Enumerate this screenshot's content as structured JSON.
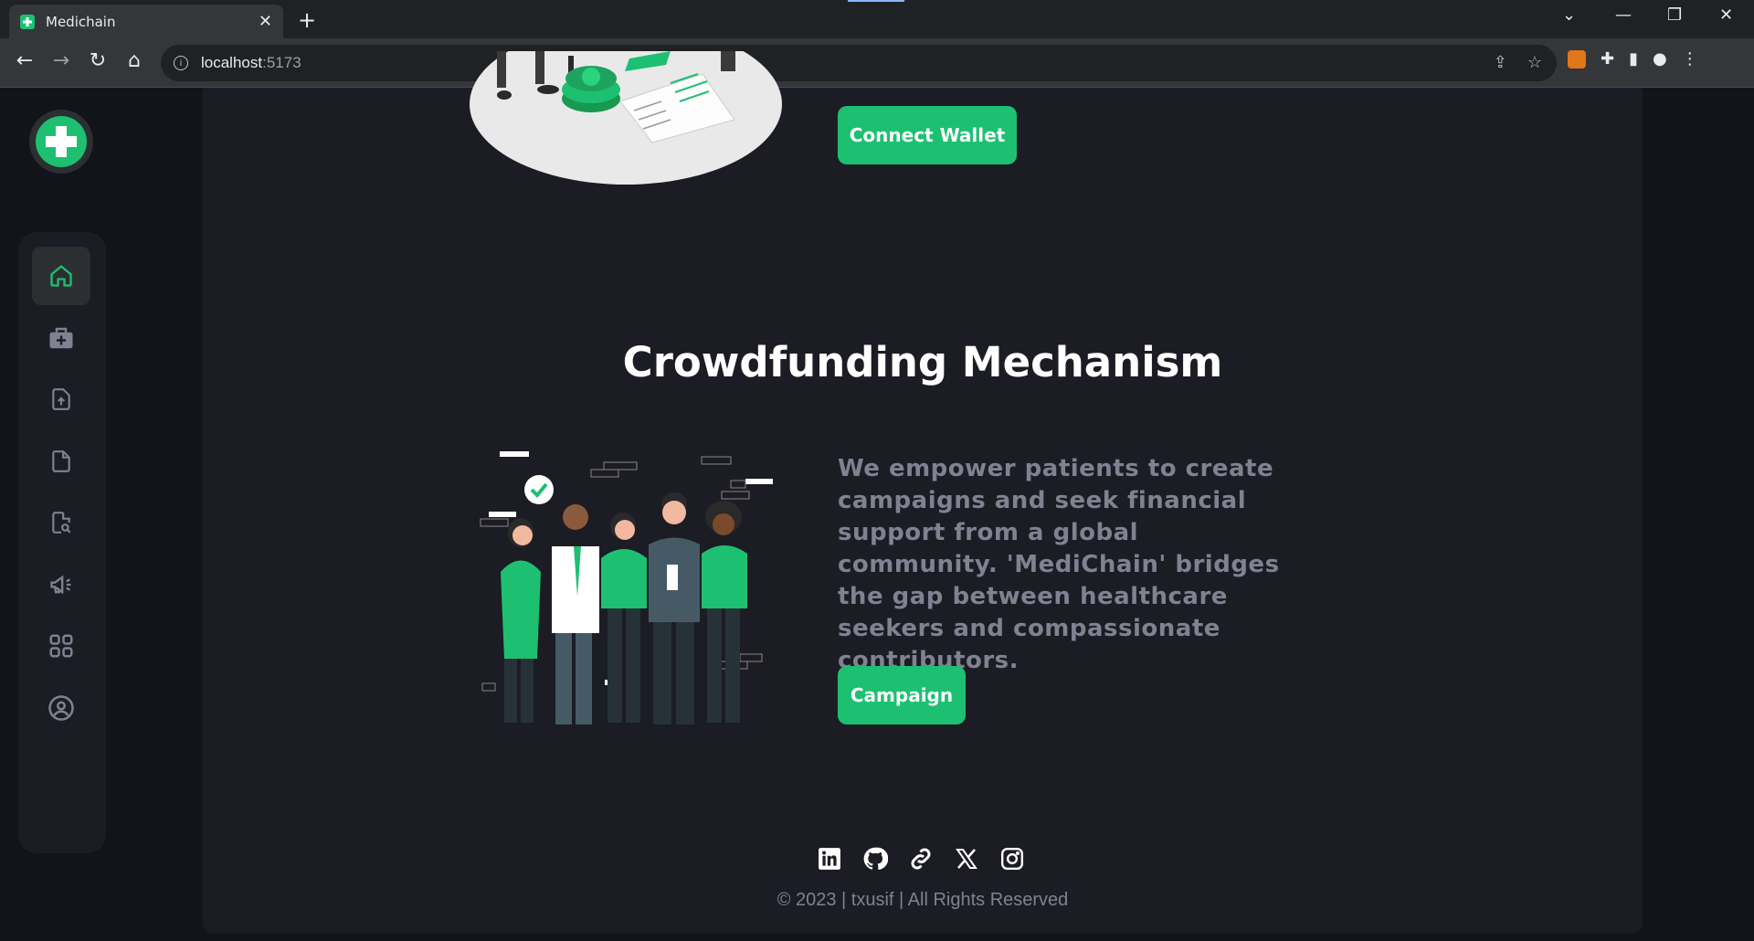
{
  "browser": {
    "tab_title": "Medichain",
    "url_host": "localhost",
    "url_port": ":5173"
  },
  "hero": {
    "connect_label": "Connect Wallet"
  },
  "section": {
    "title": "Crowdfunding Mechanism",
    "description": "We empower patients to create campaigns and seek financial support from a global community. 'MediChain' bridges the gap between healthcare seekers and compassionate contributors.",
    "campaign_label": "Campaign"
  },
  "sidebar": {
    "items": [
      "home-icon",
      "medical-kit-icon",
      "file-upload-icon",
      "document-icon",
      "file-search-icon",
      "megaphone-icon",
      "apps-grid-icon",
      "profile-icon"
    ],
    "active": "home-icon"
  },
  "footer": {
    "socials": [
      "linkedin-icon",
      "github-icon",
      "link-icon",
      "x-icon",
      "instagram-icon"
    ],
    "copyright": "© 2023 | txusif | All Rights Reserved"
  },
  "colors": {
    "accent": "#1dc071",
    "background": "#13131a",
    "card": "#1c1c24",
    "muted_text": "#808191"
  }
}
